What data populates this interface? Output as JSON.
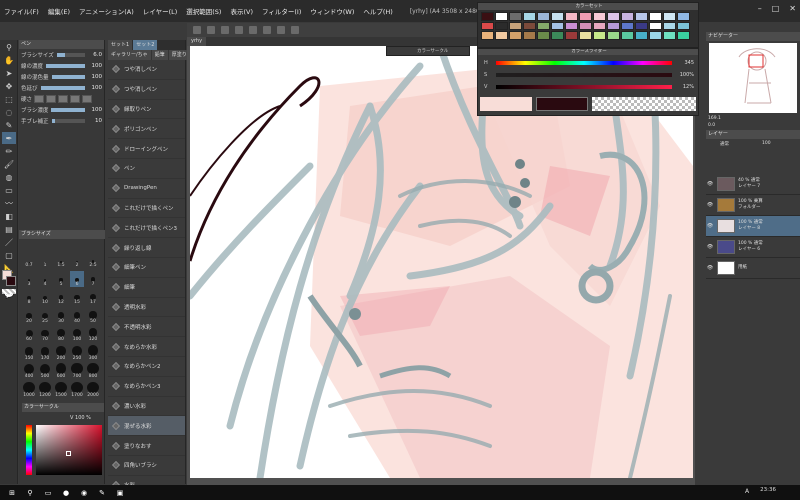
{
  "menubar": {
    "items": [
      "ファイル(F)",
      "編集(E)",
      "アニメーション(A)",
      "レイヤー(L)",
      "選択範囲(S)",
      "表示(V)",
      "フィルター(I)",
      "ウィンドウ(W)",
      "ヘルプ(H)"
    ],
    "title": "[yrhy] (A4 3508 x 2480px 350dpi 161.2%) - C..."
  },
  "window_controls": [
    "–",
    "□",
    "✕"
  ],
  "subtool_panel": {
    "title": "ペン",
    "brush_size_label": "ブラシサイズ",
    "brush_size_value": "6.0",
    "properties": [
      {
        "label": "線の濃度",
        "value": "100"
      },
      {
        "label": "線の混色量",
        "value": "100"
      },
      {
        "label": "色延び",
        "value": "100"
      },
      {
        "label": "硬さ",
        "value": ""
      },
      {
        "label": "ブラシ濃度",
        "value": "100"
      },
      {
        "label": "手ブレ補正",
        "value": "10"
      }
    ]
  },
  "brush_sizes": {
    "title": "ブラシサイズ",
    "values": [
      "0.7",
      "1",
      "1.5",
      "2",
      "2.5",
      "3",
      "4",
      "5",
      "6",
      "7",
      "8",
      "10",
      "12",
      "15",
      "17",
      "20",
      "25",
      "30",
      "40",
      "50",
      "60",
      "70",
      "80",
      "100",
      "120",
      "150",
      "170",
      "200",
      "250",
      "300",
      "400",
      "500",
      "600",
      "700",
      "800",
      "1000",
      "1200",
      "1500",
      "1700",
      "2000"
    ],
    "selected": "6"
  },
  "color_wheel": {
    "title": "カラーサークル",
    "v_label": "V",
    "v_value": "100",
    "percent": "%"
  },
  "brush_list": {
    "tabs": [
      "セット1",
      "セット2",
      "ギャラリー/ちゃ",
      "鉛筆",
      "厚塗り"
    ],
    "items": [
      "つや消しペン",
      "つや消しペン",
      "縁取りペン",
      "ポリゴンペン",
      "ドローイングペン",
      "ペン",
      "DrawingPen",
      "これだけで描くペン",
      "これだけで描くペン3",
      "繰り返し線",
      "細筆ペン",
      "細筆",
      "透明水彩",
      "不透明水彩",
      "なめらか水彩",
      "なめらかペン2",
      "なめらかペン3",
      "濃い水彩",
      "混ぜる水彩",
      "塗りなおす",
      "四角いブラシ",
      "水彩"
    ],
    "selected_index": 18
  },
  "canvas": {
    "tab": "yrhy",
    "bg_color": "#fefefe"
  },
  "palette": {
    "title": "カラーセット",
    "colors": [
      "#3a0f12",
      "#ffffff",
      "#6c6c6c",
      "#a6d6e6",
      "#9bb6d8",
      "#c5e0ef",
      "#f4b7c5",
      "#ef9bb2",
      "#f7c9d6",
      "#dcc4e8",
      "#c7b3e0",
      "#b7c7ea",
      "#ffffff",
      "#cfe6f3",
      "#8fb7e3",
      "#d94a4a",
      "#2b2b2b",
      "#c6a27a",
      "#7b4a3a",
      "#84a96a",
      "#a4c1e5",
      "#c98fd3",
      "#d48fb8",
      "#e6a8c0",
      "#b79ad8",
      "#5d77c9",
      "#3a3a86",
      "#ffffff",
      "#a9d7e8",
      "#7bc3d8",
      "#e8b27a",
      "#f1c9a0",
      "#d3a16a",
      "#a57a4a",
      "#6a8a4a",
      "#3c8a5a",
      "#9a3a3a",
      "#e8e0a0",
      "#c6e88a",
      "#9ad88a",
      "#5ac8a0",
      "#48b0c8",
      "#9ad6e8",
      "#6ee0c0",
      "#3ad0a0"
    ]
  },
  "color_slider": {
    "title": "カラースライダー",
    "rows": [
      {
        "label": "H",
        "value": "345"
      },
      {
        "label": "S",
        "value": "100%"
      },
      {
        "label": "V",
        "value": "12%"
      }
    ],
    "current_color": "#2a0a10"
  },
  "mini_popup": {
    "label": "カラーサークル"
  },
  "navigator": {
    "title": "ナビゲーター",
    "zoom": "169.1",
    "angle": "0.0"
  },
  "layer_panel": {
    "title": "レイヤー",
    "blend_mode": "通常",
    "opacity": "100",
    "layers": [
      {
        "name": "40 % 通常\nレイヤー 7",
        "thumb": "#6b5a5e",
        "selected": false
      },
      {
        "name": "100 % 乗算\nフォルダー",
        "thumb": "#a57a3a",
        "selected": false
      },
      {
        "name": "100 % 通常\nレイヤー 8",
        "thumb": "#e8dfe0",
        "selected": true
      },
      {
        "name": "100 % 通常\nレイヤー 6",
        "thumb": "#4a4a8a",
        "selected": false
      },
      {
        "name": "用紙",
        "thumb": "#ffffff",
        "selected": false
      }
    ]
  },
  "taskbar": {
    "time": "23:36",
    "lang": "A"
  }
}
